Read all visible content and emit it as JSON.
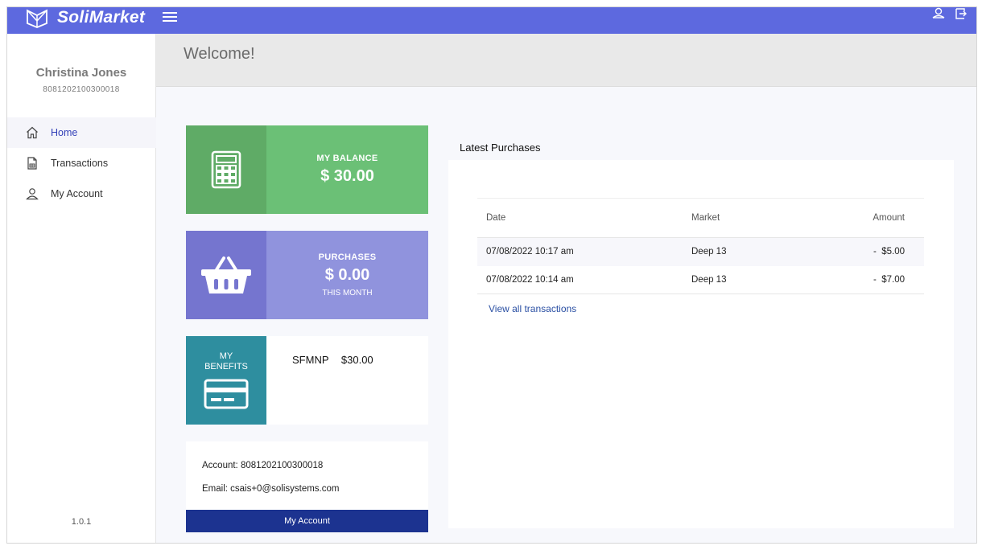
{
  "app": {
    "brand": "SoliMarket"
  },
  "user": {
    "name": "Christina Jones",
    "id": "8081202100300018"
  },
  "sidebar": {
    "items": [
      {
        "label": "Home",
        "icon": "home-icon",
        "active": true
      },
      {
        "label": "Transactions",
        "icon": "document-icon",
        "active": false
      },
      {
        "label": "My Account",
        "icon": "user-icon",
        "active": false
      }
    ],
    "version": "1.0.1"
  },
  "header": {
    "welcome": "Welcome!"
  },
  "cards": {
    "balance": {
      "label": "MY BALANCE",
      "value": "$ 30.00",
      "icon": "calculator-icon"
    },
    "purchases": {
      "label": "PURCHASES",
      "value": "$ 0.00",
      "sub": "THIS MONTH",
      "icon": "basket-icon"
    },
    "benefits": {
      "label_line1": "MY",
      "label_line2": "BENEFITS",
      "icon": "card-icon",
      "program": "SFMNP",
      "amount": "$30.00"
    }
  },
  "account": {
    "account_line": "Account: 8081202100300018",
    "email_line": "Email: csais+0@solisystems.com",
    "button": "My Account"
  },
  "latest_purchases": {
    "title": "Latest Purchases",
    "columns": [
      "Date",
      "Market",
      "Amount"
    ],
    "rows": [
      {
        "date": "07/08/2022 10:17 am",
        "market": "Deep 13",
        "amount": "-  $5.00"
      },
      {
        "date": "07/08/2022 10:14 am",
        "market": "Deep 13",
        "amount": "-  $7.00"
      }
    ],
    "view_all": "View all transactions"
  },
  "colors": {
    "topbar": "#5d69df",
    "balance": "#6bc076",
    "purchases": "#9093dd",
    "benefits": "#2e8e9f",
    "account_button": "#1c3390"
  }
}
